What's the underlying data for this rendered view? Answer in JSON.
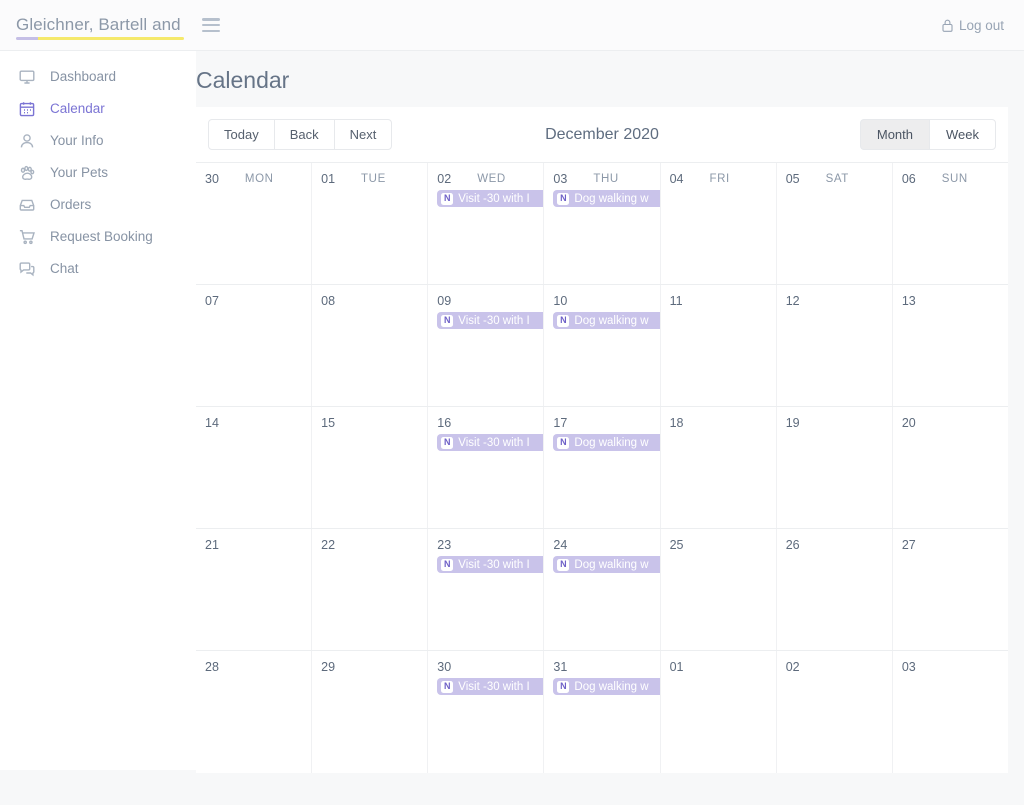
{
  "topbar": {
    "brand": "Gleichner, Bartell and Monahan",
    "menu_icon": "hamburger-icon",
    "logout_label": "Log out",
    "logout_icon": "lock-icon",
    "underline_color_a": "#c5bfe6",
    "underline_color_b": "#f5e96b"
  },
  "sidebar": {
    "items": [
      {
        "label": "Dashboard",
        "icon": "monitor-icon",
        "active": false
      },
      {
        "label": "Calendar",
        "icon": "calendar-icon",
        "active": true
      },
      {
        "label": "Your Info",
        "icon": "user-icon",
        "active": false
      },
      {
        "label": "Your Pets",
        "icon": "paw-icon",
        "active": false
      },
      {
        "label": "Orders",
        "icon": "inbox-icon",
        "active": false
      },
      {
        "label": "Request Booking",
        "icon": "cart-icon",
        "active": false
      },
      {
        "label": "Chat",
        "icon": "chat-icon",
        "active": false
      }
    ],
    "active_color": "#7b74d4"
  },
  "main": {
    "page_title": "Calendar"
  },
  "toolbar": {
    "today_label": "Today",
    "back_label": "Back",
    "next_label": "Next",
    "current_range": "December 2020",
    "views": [
      {
        "label": "Month",
        "active": true
      },
      {
        "label": "Week",
        "active": false
      }
    ]
  },
  "calendar": {
    "weekday_headers": [
      "MON",
      "TUE",
      "WED",
      "THU",
      "FRI",
      "SAT",
      "SUN"
    ],
    "event_color": "#c9c3ea",
    "event_badge": "N",
    "rows": [
      {
        "cells": [
          {
            "day": "30",
            "weekday": "MON",
            "events": []
          },
          {
            "day": "01",
            "weekday": "TUE",
            "events": []
          },
          {
            "day": "02",
            "weekday": "WED",
            "events": [
              {
                "badge": "N",
                "title": "Visit -30 with I"
              }
            ]
          },
          {
            "day": "03",
            "weekday": "THU",
            "events": [
              {
                "badge": "N",
                "title": "Dog walking w"
              }
            ]
          },
          {
            "day": "04",
            "weekday": "FRI",
            "events": []
          },
          {
            "day": "05",
            "weekday": "SAT",
            "events": []
          },
          {
            "day": "06",
            "weekday": "SUN",
            "events": []
          }
        ]
      },
      {
        "cells": [
          {
            "day": "07",
            "weekday": "",
            "events": []
          },
          {
            "day": "08",
            "weekday": "",
            "events": []
          },
          {
            "day": "09",
            "weekday": "",
            "events": [
              {
                "badge": "N",
                "title": "Visit -30 with I"
              }
            ]
          },
          {
            "day": "10",
            "weekday": "",
            "events": [
              {
                "badge": "N",
                "title": "Dog walking w"
              }
            ]
          },
          {
            "day": "11",
            "weekday": "",
            "events": []
          },
          {
            "day": "12",
            "weekday": "",
            "events": []
          },
          {
            "day": "13",
            "weekday": "",
            "events": []
          }
        ]
      },
      {
        "cells": [
          {
            "day": "14",
            "weekday": "",
            "events": []
          },
          {
            "day": "15",
            "weekday": "",
            "events": []
          },
          {
            "day": "16",
            "weekday": "",
            "events": [
              {
                "badge": "N",
                "title": "Visit -30 with I"
              }
            ]
          },
          {
            "day": "17",
            "weekday": "",
            "events": [
              {
                "badge": "N",
                "title": "Dog walking w"
              }
            ]
          },
          {
            "day": "18",
            "weekday": "",
            "events": []
          },
          {
            "day": "19",
            "weekday": "",
            "events": []
          },
          {
            "day": "20",
            "weekday": "",
            "events": []
          }
        ]
      },
      {
        "cells": [
          {
            "day": "21",
            "weekday": "",
            "events": []
          },
          {
            "day": "22",
            "weekday": "",
            "events": []
          },
          {
            "day": "23",
            "weekday": "",
            "events": [
              {
                "badge": "N",
                "title": "Visit -30 with I"
              }
            ]
          },
          {
            "day": "24",
            "weekday": "",
            "events": [
              {
                "badge": "N",
                "title": "Dog walking w"
              }
            ]
          },
          {
            "day": "25",
            "weekday": "",
            "events": []
          },
          {
            "day": "26",
            "weekday": "",
            "events": []
          },
          {
            "day": "27",
            "weekday": "",
            "events": []
          }
        ]
      },
      {
        "cells": [
          {
            "day": "28",
            "weekday": "",
            "events": []
          },
          {
            "day": "29",
            "weekday": "",
            "events": []
          },
          {
            "day": "30",
            "weekday": "",
            "events": [
              {
                "badge": "N",
                "title": "Visit -30 with I"
              }
            ]
          },
          {
            "day": "31",
            "weekday": "",
            "events": [
              {
                "badge": "N",
                "title": "Dog walking w"
              }
            ]
          },
          {
            "day": "01",
            "weekday": "",
            "events": []
          },
          {
            "day": "02",
            "weekday": "",
            "events": []
          },
          {
            "day": "03",
            "weekday": "",
            "events": []
          }
        ]
      }
    ]
  }
}
